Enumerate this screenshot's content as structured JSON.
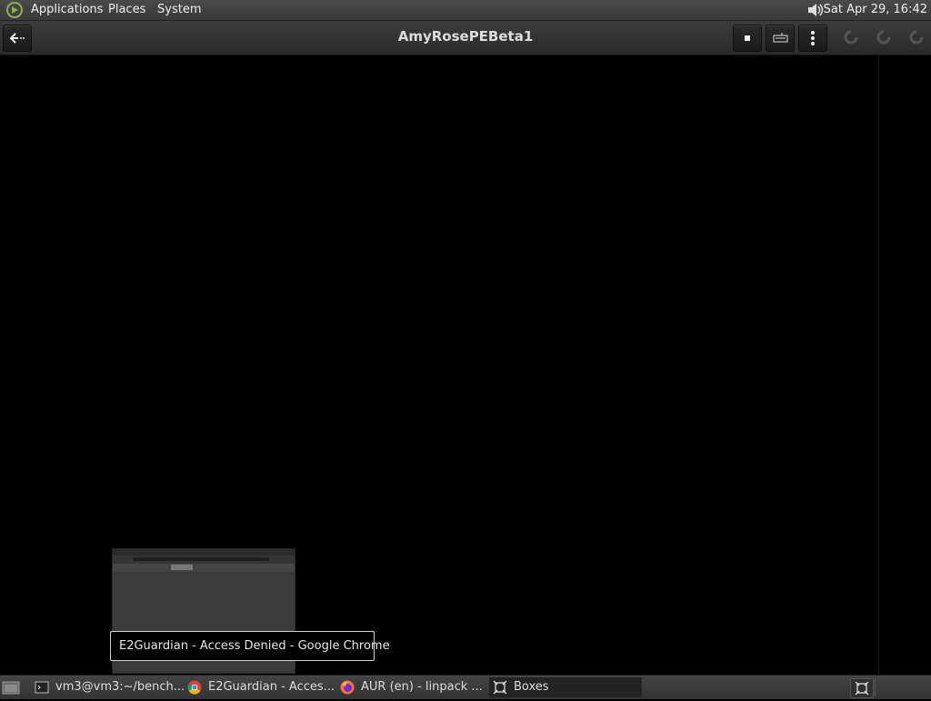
{
  "top_panel": {
    "menus": [
      "Applications",
      "Places",
      "System"
    ],
    "clock": "Sat Apr 29, 16:42",
    "icons": [
      "distro-logo-icon",
      "volume-icon"
    ]
  },
  "header": {
    "title": "AmyRosePEBeta1",
    "buttons": [
      "back-arrow-icon",
      "stop-icon",
      "keyboard-icon",
      "menu-dots-icon"
    ],
    "status_icons": [
      "spinner-icon",
      "spinner-icon",
      "spinner-icon"
    ]
  },
  "tooltip": {
    "text": "E2Guardian - Access Denied - Google Chrome"
  },
  "taskbar": {
    "tasks": [
      {
        "label": "vm3@vm3:~/bench...",
        "icon": "terminal-icon"
      },
      {
        "label": "E2Guardian - Acces...",
        "icon": "chrome-icon"
      },
      {
        "label": "AUR (en) - linpack ...",
        "icon": "firefox-icon"
      },
      {
        "label": "Boxes",
        "icon": "boxes-icon"
      }
    ]
  },
  "colors": {
    "panel": "#3a3a3a",
    "display": "#000000",
    "tooltip_border": "#cfcfcf"
  }
}
